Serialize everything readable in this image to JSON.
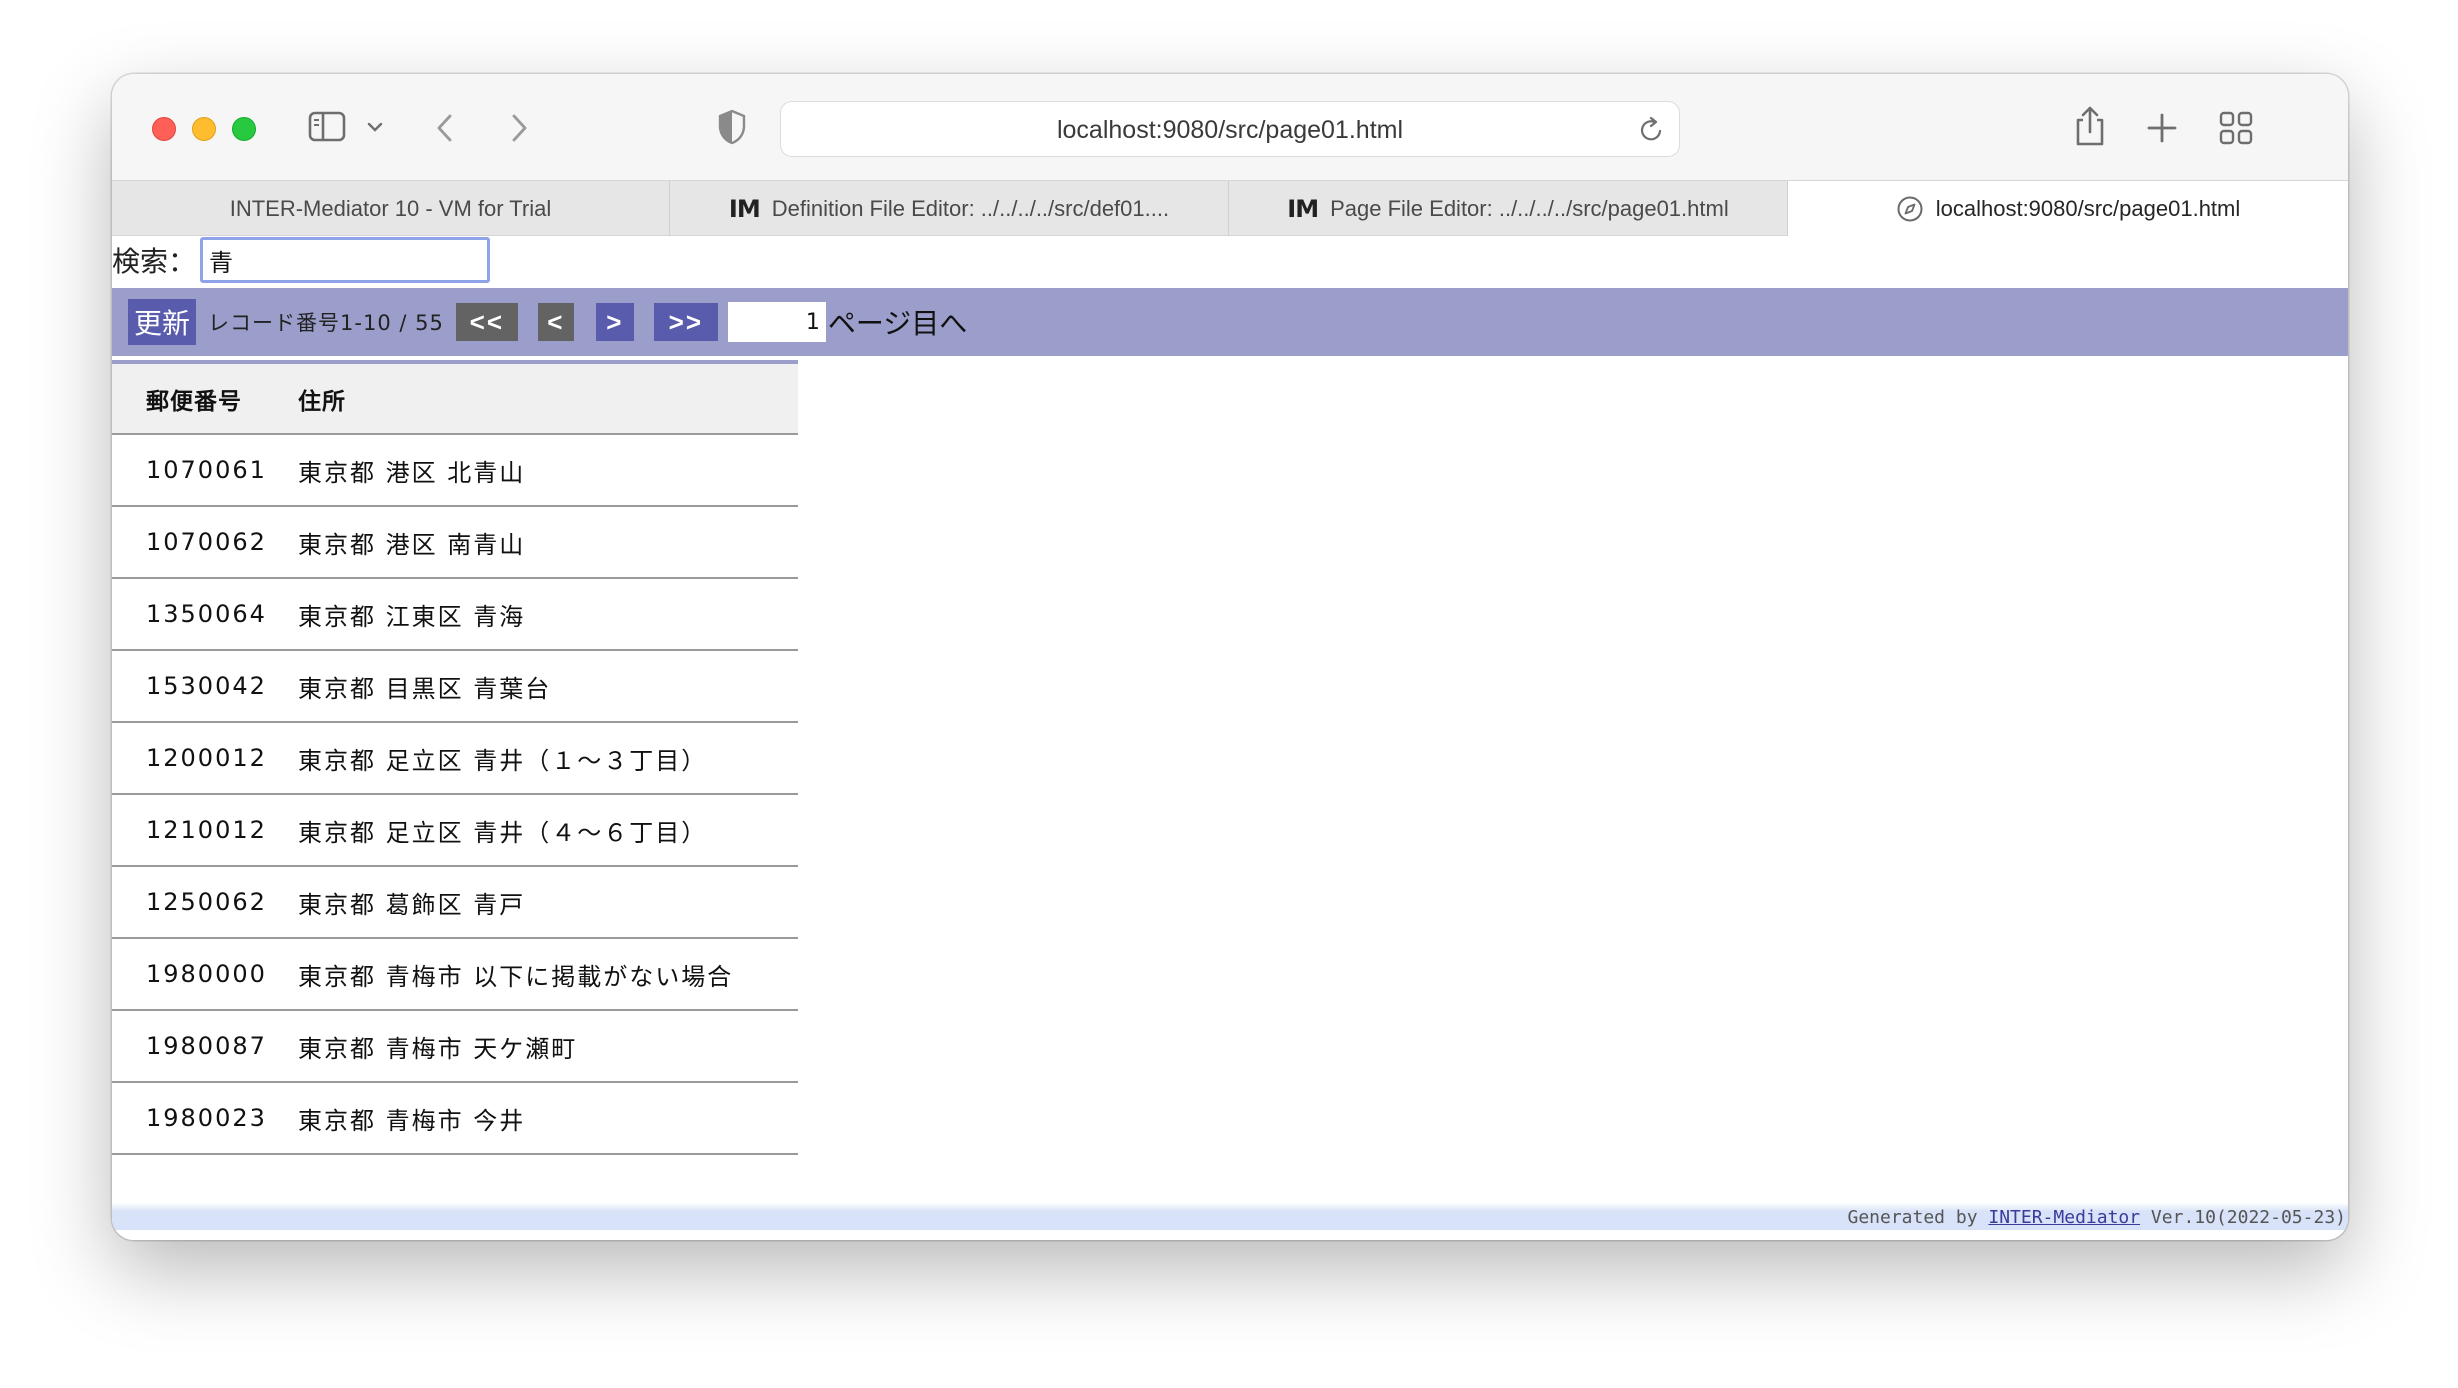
{
  "browser": {
    "url": "localhost:9080/src/page01.html",
    "tabs": [
      {
        "label": "INTER-Mediator 10 - VM for Trial",
        "icon": ""
      },
      {
        "label": "Definition File Editor: ../../../../src/def01....",
        "icon": "IM"
      },
      {
        "label": "Page File Editor: ../../../../src/page01.html",
        "icon": "IM"
      },
      {
        "label": "localhost:9080/src/page01.html",
        "icon": "compass-icon"
      }
    ]
  },
  "search": {
    "label": "検索：",
    "value": "青"
  },
  "navigation": {
    "update_label": "更新",
    "record_info": "レコード番号1-10 / 55",
    "first_label": "<<",
    "prev_label": "<",
    "next_label": ">",
    "last_label": ">>",
    "page_value": "1",
    "page_suffix": "ページ目へ"
  },
  "table": {
    "headers": [
      "郵便番号",
      "住所"
    ],
    "rows": [
      [
        "1070061",
        "東京都 港区 北青山"
      ],
      [
        "1070062",
        "東京都 港区 南青山"
      ],
      [
        "1350064",
        "東京都 江東区 青海"
      ],
      [
        "1530042",
        "東京都 目黒区 青葉台"
      ],
      [
        "1200012",
        "東京都 足立区 青井（１～３丁目）"
      ],
      [
        "1210012",
        "東京都 足立区 青井（４～６丁目）"
      ],
      [
        "1250062",
        "東京都 葛飾区 青戸"
      ],
      [
        "1980000",
        "東京都 青梅市 以下に掲載がない場合"
      ],
      [
        "1980087",
        "東京都 青梅市 天ケ瀬町"
      ],
      [
        "1980023",
        "東京都 青梅市 今井"
      ]
    ]
  },
  "footer": {
    "prefix": "Generated by ",
    "link": "INTER-Mediator",
    "suffix": " Ver.10(2022-05-23)"
  },
  "colors": {
    "nav_bar": "#9b9ecb",
    "button_blue": "#595bad",
    "button_gray": "#636363"
  }
}
